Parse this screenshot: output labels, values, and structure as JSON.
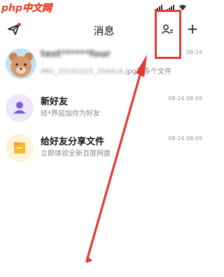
{
  "watermark": {
    "part1": "php",
    "part2": "中文网"
  },
  "status_bar": {
    "time_hidden": true
  },
  "header": {
    "title": "消息",
    "add_label": "+"
  },
  "conversations": [
    {
      "name": "test******four",
      "message_blurred": "IMG_20191015_204416",
      "message_suffix": ".jpg等多个文件",
      "time": "08:14",
      "avatar": "bear-avatar"
    },
    {
      "name": "新好友",
      "message": "经*界屈加你为好友",
      "time": "08-24 08:09",
      "avatar": "person-icon",
      "avatar_bg": "#ede7fb",
      "icon_color": "#7d5ae0"
    },
    {
      "name": "给好友分享文件",
      "message": "立即体验全新百度网盘",
      "time": "08-24 08:09",
      "avatar": "folder-icon",
      "avatar_bg": "#fdf3d6",
      "icon_color": "#f5b82e"
    }
  ],
  "annotation": {
    "color": "#e53935"
  }
}
